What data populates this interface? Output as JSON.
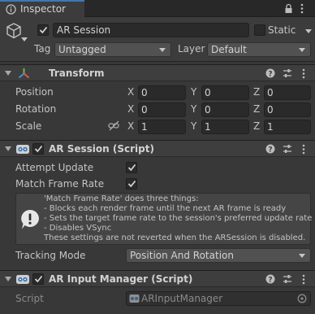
{
  "tab": {
    "title": "Inspector"
  },
  "header": {
    "object_name": "AR Session",
    "static_label": "Static",
    "tag_label": "Tag",
    "tag_value": "Untagged",
    "layer_label": "Layer",
    "layer_value": "Default"
  },
  "transform": {
    "title": "Transform",
    "rows": [
      {
        "label": "Position",
        "x": "0",
        "y": "0",
        "z": "0"
      },
      {
        "label": "Rotation",
        "x": "0",
        "y": "0",
        "z": "0"
      },
      {
        "label": "Scale",
        "x": "1",
        "y": "1",
        "z": "1"
      }
    ],
    "axis_x": "X",
    "axis_y": "Y",
    "axis_z": "Z"
  },
  "ar_session": {
    "title": "AR Session (Script)",
    "attempt_update_label": "Attempt Update",
    "match_frame_rate_label": "Match Frame Rate",
    "help_lines": [
      "'Match Frame Rate' does three things:",
      "- Blocks each render frame until the next AR frame is ready",
      "- Sets the target frame rate to the session's preferred update rate",
      "- Disables VSync",
      "These settings are not reverted when the ARSession is disabled."
    ],
    "tracking_mode_label": "Tracking Mode",
    "tracking_mode_value": "Position And Rotation"
  },
  "ar_input_manager": {
    "title": "AR Input Manager (Script)",
    "script_label": "Script",
    "script_value": "ARInputManager"
  }
}
